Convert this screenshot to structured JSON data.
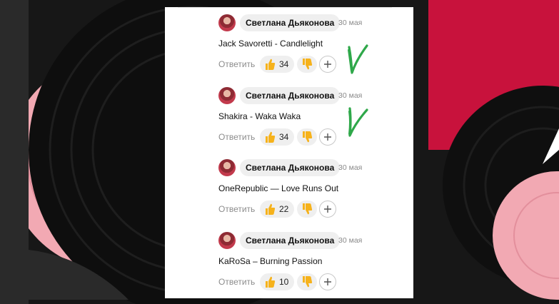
{
  "comments": [
    {
      "author": "Светлана Дьяконова",
      "date": "30 мая",
      "text": "Jack Savoretti - Candlelight",
      "reply_label": "Ответить",
      "likes": "34",
      "marked": true
    },
    {
      "author": "Светлана Дьяконова",
      "date": "30 мая",
      "text": "Shakira - Waka Waka",
      "reply_label": "Ответить",
      "likes": "34",
      "marked": true
    },
    {
      "author": "Светлана Дьяконова",
      "date": "30 мая",
      "text": "OneRepublic — Love Runs Out",
      "reply_label": "Ответить",
      "likes": "22",
      "marked": false
    },
    {
      "author": "Светлана Дьяконова",
      "date": "30 мая",
      "text": "KaRoSa – Burning Passion",
      "reply_label": "Ответить",
      "likes": "10",
      "marked": false
    }
  ],
  "icons": {
    "like": "thumbs-up-icon",
    "dislike": "thumbs-down-icon",
    "add": "plus-icon",
    "mark": "check-mark-icon"
  },
  "colors": {
    "accent_pink": "#f2a9b3",
    "background_red": "#c8123c",
    "vinyl_black": "#111111",
    "check_green": "#2fa84a",
    "reaction_yellow": "#f6b21b"
  }
}
